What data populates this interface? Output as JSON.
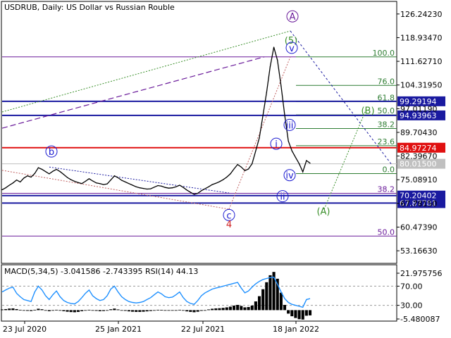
{
  "header": {
    "title": "USDRUB, Daily:  US Dollar vs Russian Rouble"
  },
  "price_axis": {
    "ticks": [
      "126.24230",
      "118.93470",
      "111.62710",
      "104.31950",
      "97.01190",
      "89.70430",
      "82.39670",
      "75.08910",
      "67.78150",
      "60.47390",
      "53.16630"
    ],
    "highlight_labels": [
      {
        "text": "99.29194",
        "value": 99.29194,
        "bg": "#1a1aa0"
      },
      {
        "text": "94.93963",
        "value": 94.93963,
        "bg": "#1a1aa0"
      },
      {
        "text": "84.97274",
        "value": 84.97274,
        "bg": "#e01010"
      },
      {
        "text": "80.01500",
        "value": 80.015,
        "bg": "#c0c0c0"
      },
      {
        "text": "70.20402",
        "value": 70.20402,
        "bg": "#1a1aa0"
      },
      {
        "text": "67.87781",
        "value": 67.87781,
        "bg": "#1a1aa0"
      }
    ]
  },
  "osc_axis": {
    "ticks": [
      "21.975756",
      "70.00",
      "30.00",
      "-5.480087"
    ]
  },
  "indicator_label": "MACD(5,34,5) -3.041586 -2.743395 RSI(14) 44.13",
  "time_axis": [
    "23 Jul 2020",
    "25 Jan 2021",
    "22 Jul 2021",
    "18 Jan 2022"
  ],
  "fib_levels": [
    {
      "label": "100.0",
      "value": 113.0
    },
    {
      "label": "76.0",
      "value": 104.2
    },
    {
      "label": "61.8",
      "value": 99.2
    },
    {
      "label": "50.0",
      "value": 95.1
    },
    {
      "label": "38.2",
      "value": 90.9
    },
    {
      "label": "23.6",
      "value": 85.6
    },
    {
      "label": "0.0",
      "value": 77.0
    }
  ],
  "fib_lower": [
    {
      "label": "38.2",
      "value": 70.9
    },
    {
      "label": "50.0",
      "value": 57.7
    }
  ],
  "waves": [
    {
      "text": "A",
      "color": "#6a1b9a",
      "circle": true
    },
    {
      "text": "5",
      "color": "#3a8f2a",
      "paren": true
    },
    {
      "text": "v",
      "color": "#1a1ad0",
      "circle": true
    },
    {
      "text": "iii",
      "color": "#1a1ad0",
      "circle": true
    },
    {
      "text": "i",
      "color": "#1a1ad0",
      "circle": true
    },
    {
      "text": "iv",
      "color": "#1a1ad0",
      "circle": true
    },
    {
      "text": "ii",
      "color": "#1a1ad0",
      "circle": true
    },
    {
      "text": "b",
      "color": "#1a1ad0",
      "circle": true
    },
    {
      "text": "c",
      "color": "#1a1ad0",
      "circle": true
    },
    {
      "text": "4",
      "color": "#d02020"
    },
    {
      "text": "(B)",
      "color": "#3a8f2a"
    },
    {
      "text": "(A)",
      "color": "#3a8f2a"
    }
  ],
  "colors": {
    "price": "#000000",
    "macd_fill": "#000000",
    "rsi_line": "#1e90ff",
    "fib_green": "#2e7d32",
    "purple_line": "#6a1b9a"
  },
  "chart_data": {
    "type": "line",
    "title": "USDRUB, Daily:  US Dollar vs Russian Rouble",
    "xlabel": "",
    "ylabel": "",
    "x_ticks": [
      "23 Jul 2020",
      "25 Jan 2021",
      "22 Jul 2021",
      "18 Jan 2022"
    ],
    "ylim": [
      49.5,
      129.9
    ],
    "series": [
      {
        "values": [
          72.0,
          72.6,
          73.4,
          74.1,
          75.0,
          74.4,
          75.6,
          76.3,
          75.9,
          77.0,
          78.8,
          78.3,
          77.6,
          76.9,
          77.7,
          78.3,
          77.6,
          76.7,
          75.8,
          75.1,
          74.6,
          74.2,
          73.9,
          74.6,
          75.4,
          74.7,
          74.1,
          73.9,
          73.6,
          73.8,
          75.0,
          76.3,
          75.7,
          74.9,
          74.4,
          73.9,
          73.4,
          72.9,
          72.6,
          72.4,
          72.2,
          72.3,
          72.8,
          73.3,
          73.1,
          72.7,
          72.5,
          72.6,
          72.9,
          73.4,
          72.7,
          71.9,
          71.2,
          70.6,
          70.9,
          71.7,
          72.3,
          72.9,
          73.6,
          74.0,
          74.5,
          75.1,
          75.9,
          76.9,
          78.4,
          79.8,
          79.0,
          77.9,
          78.4,
          80.0,
          84.0,
          88.0,
          95.0,
          102.0,
          110.0,
          116.0,
          112.0,
          104.0,
          95.0,
          87.0,
          84.0,
          82.0,
          80.0,
          77.5,
          81.0,
          80.2
        ]
      }
    ],
    "indicators": {
      "macd_histogram": [
        0.4,
        0.6,
        0.9,
        1.0,
        0.6,
        0.2,
        -0.2,
        -0.4,
        -0.5,
        0.2,
        0.8,
        0.5,
        -0.1,
        -0.6,
        -0.3,
        0.2,
        -0.2,
        -0.6,
        -0.9,
        -1.1,
        -1.2,
        -1.0,
        -0.6,
        -0.2,
        0.2,
        -0.1,
        -0.4,
        -0.6,
        -0.5,
        -0.1,
        0.5,
        0.9,
        0.4,
        -0.1,
        -0.4,
        -0.7,
        -0.9,
        -1.0,
        -1.0,
        -0.9,
        -0.7,
        -0.5,
        -0.1,
        0.2,
        0.1,
        -0.2,
        -0.3,
        -0.3,
        -0.1,
        0.2,
        -0.2,
        -0.7,
        -1.0,
        -1.2,
        -0.9,
        -0.4,
        0.0,
        0.4,
        0.8,
        1.0,
        1.1,
        1.3,
        1.6,
        2.0,
        2.6,
        3.0,
        2.4,
        1.6,
        1.8,
        2.6,
        5.0,
        8.0,
        12.0,
        16.0,
        20.0,
        21.9,
        18.0,
        10.0,
        3.0,
        -2.0,
        -3.5,
        -4.5,
        -5.2,
        -5.4,
        -3.2,
        -3.0
      ],
      "rsi": [
        58,
        62,
        66,
        68,
        55,
        48,
        42,
        40,
        38,
        58,
        70,
        62,
        50,
        42,
        52,
        60,
        48,
        40,
        36,
        34,
        33,
        38,
        46,
        55,
        62,
        50,
        44,
        40,
        42,
        50,
        64,
        70,
        58,
        48,
        42,
        38,
        36,
        35,
        36,
        38,
        42,
        46,
        52,
        58,
        54,
        48,
        46,
        47,
        52,
        58,
        46,
        38,
        34,
        32,
        40,
        50,
        56,
        60,
        64,
        66,
        68,
        70,
        72,
        74,
        76,
        78,
        66,
        56,
        60,
        68,
        75,
        80,
        84,
        86,
        88,
        89,
        74,
        58,
        44,
        36,
        32,
        30,
        28,
        26,
        42,
        44
      ]
    }
  }
}
